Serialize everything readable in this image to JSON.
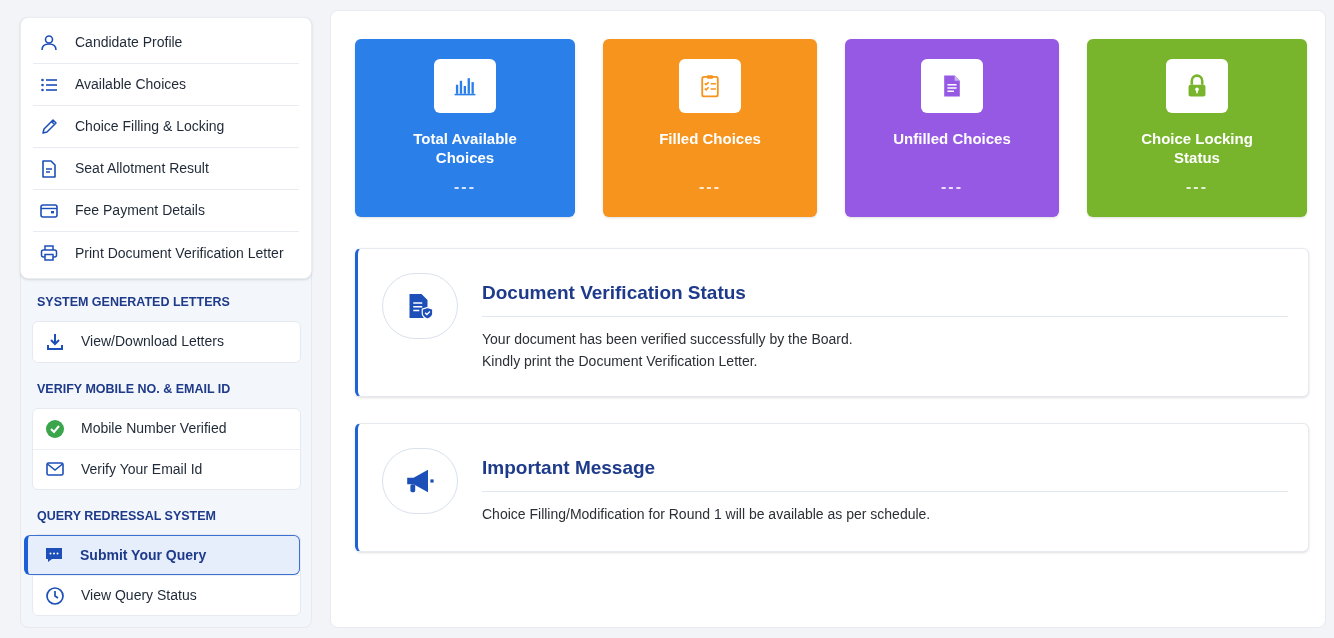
{
  "sidebar": {
    "menu": [
      {
        "label": "Candidate Profile",
        "selected": false
      },
      {
        "label": "Available Choices",
        "selected": false
      },
      {
        "label": "Choice Filling & Locking",
        "selected": false
      },
      {
        "label": "Seat Allotment Result",
        "selected": false
      },
      {
        "label": "Fee Payment Details",
        "selected": false
      },
      {
        "label": "Print Document Verification Letter",
        "selected": false
      }
    ],
    "sections": [
      {
        "heading": "SYSTEM GENERATED LETTERS",
        "items": [
          {
            "label": "View/Download Letters",
            "selected": false
          }
        ]
      },
      {
        "heading": "VERIFY MOBILE NO. & EMAIL ID",
        "items": [
          {
            "label": "Mobile Number Verified",
            "selected": false,
            "verified": true
          },
          {
            "label": "Verify Your Email Id",
            "selected": false,
            "verified": false
          }
        ]
      },
      {
        "heading": "QUERY REDRESSAL SYSTEM",
        "items": [
          {
            "label": "Submit Your Query",
            "selected": true
          },
          {
            "label": "View Query Status",
            "selected": false
          }
        ]
      }
    ]
  },
  "stats": [
    {
      "title": "Total Available Choices",
      "value": "---",
      "color": "#2a7fe8"
    },
    {
      "title": "Filled Choices",
      "value": "---",
      "color": "#f7941d"
    },
    {
      "title": "Unfilled Choices",
      "value": "---",
      "color": "#9659e4"
    },
    {
      "title": "Choice Locking Status",
      "value": "---",
      "color": "#78b52c"
    }
  ],
  "messages": [
    {
      "title": "Document Verification Status",
      "lines": [
        "Your document has been verified successfully by the Board.",
        "Kindly print the Document Verification Letter."
      ]
    },
    {
      "title": "Important Message",
      "lines": [
        "Choice Filling/Modification for Round 1 will be available as per schedule."
      ]
    }
  ]
}
